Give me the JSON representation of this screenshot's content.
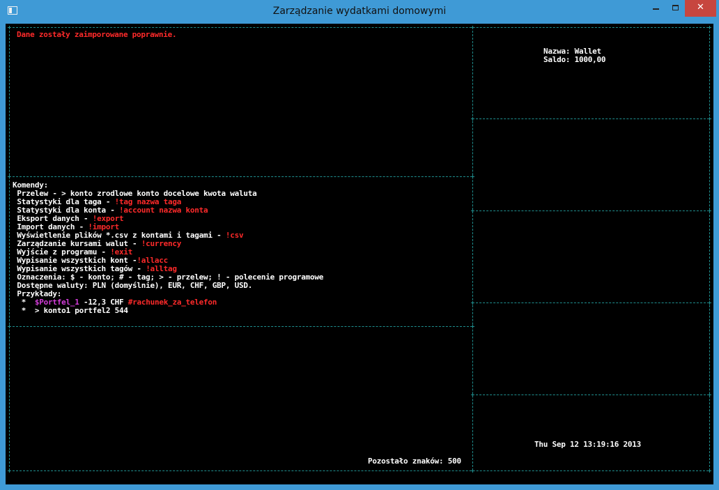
{
  "window": {
    "title": "Zarządzanie wydatkami domowymi",
    "minimize_glyph": "",
    "maximize_glyph": "",
    "close_glyph": "✕"
  },
  "status": {
    "message": "Dane zostały zaimporowane poprawnie."
  },
  "help": {
    "header": "Komendy:",
    "lines": [
      {
        "text": " Przelew - > konto zrodlowe konto docelowe kwota waluta",
        "cmd": ""
      },
      {
        "text": " Statystyki dla taga - ",
        "cmd": "!tag nazwa taga"
      },
      {
        "text": " Statystyki dla konta - ",
        "cmd": "!account nazwa konta"
      },
      {
        "text": " Eksport danych - ",
        "cmd": "!export"
      },
      {
        "text": " Import danych - ",
        "cmd": "!import"
      },
      {
        "text": " Wyświetlenie plików *.csv z kontami i tagami - ",
        "cmd": "!csv"
      },
      {
        "text": " Zarządzanie kursami walut - ",
        "cmd": "!currency"
      },
      {
        "text": " Wyjście z programu - ",
        "cmd": "!exit"
      },
      {
        "text": " Wypisanie wszystkich kont -",
        "cmd": "!allacc"
      },
      {
        "text": " Wypisanie wszystkich tagów - ",
        "cmd": "!alltag"
      },
      {
        "text": " Oznaczenia: $ - konto; # - tag; > - przelew; ! - polecenie programowe",
        "cmd": ""
      },
      {
        "text": " Dostępne waluty: PLN (domyślnie), EUR, CHF, GBP, USD.",
        "cmd": ""
      },
      {
        "text": " Przykłady:",
        "cmd": ""
      }
    ],
    "example1": {
      "bullet": "  *  ",
      "account": "$Portfel_1",
      "amount": " -12,3 CHF ",
      "tag": "#rachunek_za_telefon"
    },
    "example2": {
      "bullet": "  *  ",
      "text": "> konto1 portfel2 544"
    }
  },
  "input": {
    "remaining_label": "Pozostało znaków: 500"
  },
  "account": {
    "name_line": "Nazwa: Wallet",
    "balance_line": "Saldo: 1000,00"
  },
  "clock": {
    "datetime": "Thu Sep 12 13:19:16 2013"
  },
  "colors": {
    "title_bar": "#3f9ad6",
    "console_bg": "#000000",
    "text": "#ffffff",
    "command": "#ff2a2a",
    "account_tag": "#d43ddb",
    "border": "#1f8f8f",
    "close_button": "#c7463f"
  }
}
